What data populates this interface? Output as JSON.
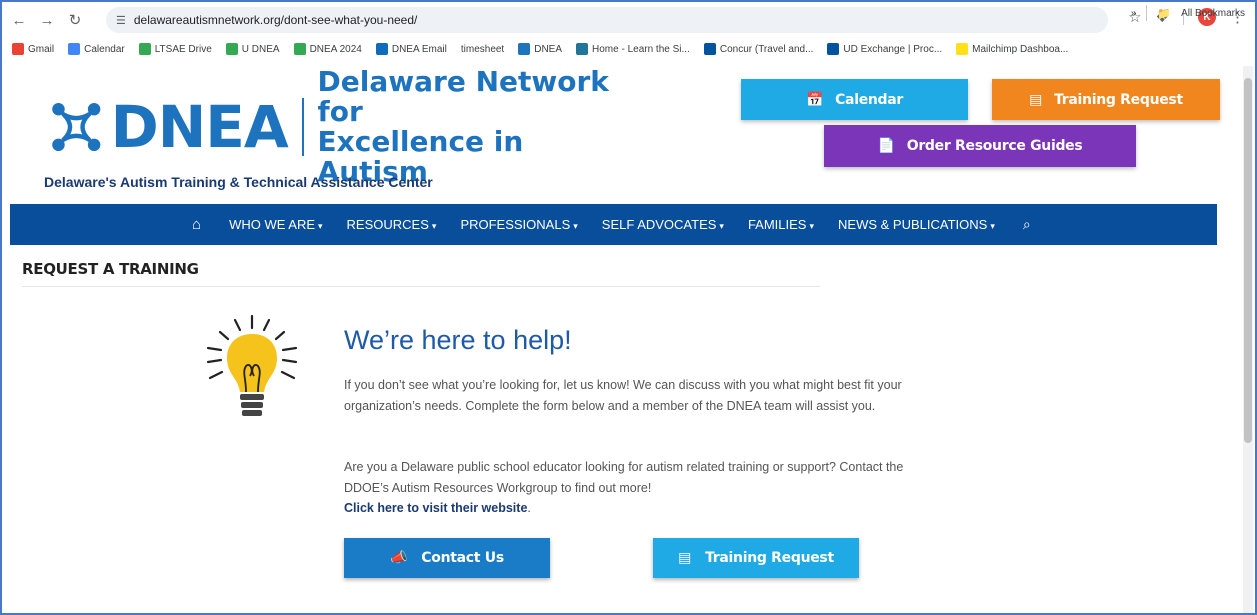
{
  "browser": {
    "url": "delawareautismnetwork.org/dont-see-what-you-need/",
    "avatar_letter": "K",
    "bookmarks": [
      {
        "label": "Gmail",
        "icon": "gmail-icon",
        "color": "#ea4335"
      },
      {
        "label": "Calendar",
        "icon": "calendar-icon",
        "color": "#4285f4"
      },
      {
        "label": "LTSAE Drive",
        "icon": "drive-icon",
        "color": "#34a853"
      },
      {
        "label": "U DNEA",
        "icon": "drive-icon",
        "color": "#34a853"
      },
      {
        "label": "DNEA 2024",
        "icon": "drive-icon",
        "color": "#34a853"
      },
      {
        "label": "DNEA Email",
        "icon": "outlook-icon",
        "color": "#0f6cbd"
      },
      {
        "label": "timesheet",
        "icon": "",
        "color": "#ffffff"
      },
      {
        "label": "DNEA",
        "icon": "dnea-icon",
        "color": "#1e73be"
      },
      {
        "label": "Home - Learn the Si...",
        "icon": "wordpress-icon",
        "color": "#21759b"
      },
      {
        "label": "Concur (Travel and...",
        "icon": "ud-icon",
        "color": "#00539f"
      },
      {
        "label": "UD Exchange | Proc...",
        "icon": "ud-icon",
        "color": "#00539f"
      },
      {
        "label": "Mailchimp Dashboa...",
        "icon": "mailchimp-icon",
        "color": "#ffe01b"
      }
    ],
    "more_label": "»",
    "all_bookmarks": "All Bookmarks"
  },
  "header": {
    "logo_text": "DNEA",
    "logo_name_line1": "Delaware Network for",
    "logo_name_line2": "Excellence in Autism",
    "tagline": "Delaware's Autism Training & Technical Assistance Center",
    "calendar_label": "Calendar",
    "training_label": "Training Request",
    "order_label": "Order Resource Guides"
  },
  "nav": {
    "items": [
      "WHO WE ARE",
      "RESOURCES",
      "PROFESSIONALS",
      "SELF ADVOCATES",
      "FAMILIES",
      "NEWS & PUBLICATIONS"
    ]
  },
  "main": {
    "page_heading": "REQUEST A TRAINING",
    "title": "We’re here to help!",
    "para1": "If you don’t see what you’re looking for, let us know! We can discuss with you what might best fit your organization’s needs. Complete the form below and a member of the DNEA team will assist you.",
    "para2": "Are you a Delaware public school educator looking for autism related training or support? Contact the DDOE’s Autism Resources Workgroup to find out more!",
    "link": "Click here to visit their website",
    "link_suffix": ".",
    "contact_label": "Contact Us",
    "training_label": "Training Request"
  },
  "colors": {
    "brand_blue": "#1e73be",
    "nav_blue": "#084e9b",
    "calendar": "#1faae6",
    "training": "#f0861d",
    "order": "#7b35b8",
    "contact": "#1a7cc7"
  }
}
